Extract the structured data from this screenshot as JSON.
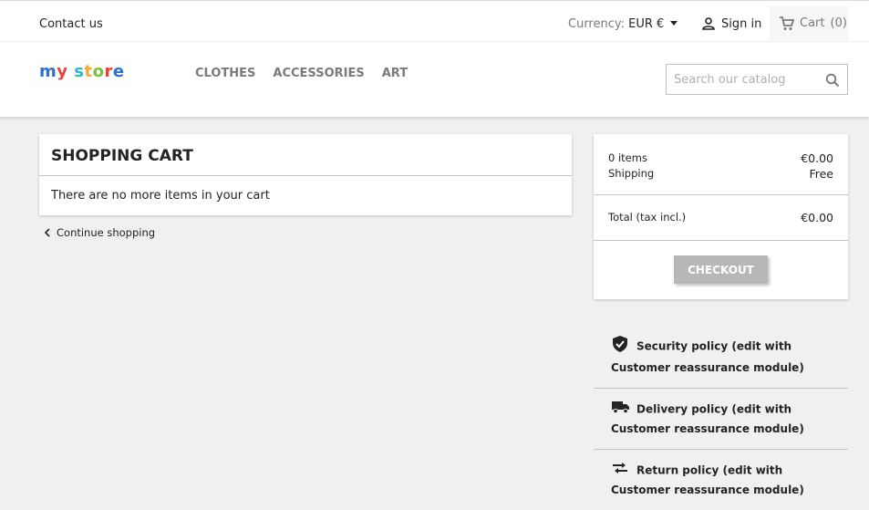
{
  "topbar": {
    "contact_label": "Contact us",
    "currency_label": "Currency:",
    "currency_value": "EUR €",
    "signin_label": "Sign in",
    "cart_label": "Cart",
    "cart_count": "(0)"
  },
  "header": {
    "logo_text": "my store",
    "nav": [
      "CLOTHES",
      "ACCESSORIES",
      "ART"
    ],
    "search_placeholder": "Search our catalog"
  },
  "cart": {
    "title": "SHOPPING CART",
    "empty_message": "There are no more items in your cart",
    "continue_label": "Continue shopping"
  },
  "summary": {
    "items_label": "0 items",
    "items_value": "€0.00",
    "shipping_label": "Shipping",
    "shipping_value": "Free",
    "total_label": "Total (tax incl.)",
    "total_value": "€0.00",
    "checkout_label": "CHECKOUT"
  },
  "reassurance": [
    {
      "icon": "shield-check-icon",
      "text": "Security policy (edit with Customer reassurance module)"
    },
    {
      "icon": "truck-icon",
      "text": "Delivery policy (edit with Customer reassurance module)"
    },
    {
      "icon": "swap-arrows-icon",
      "text": "Return policy (edit with Customer reassurance module)"
    }
  ],
  "colors": {
    "logo_m": "#2f6fce",
    "logo_y": "#e8423e",
    "logo_s": "#2fb5d2",
    "logo_t": "#f0a830",
    "logo_o": "#7bbd42",
    "logo_r": "#e8423e",
    "logo_e": "#2f6fce",
    "checkout_bg": "#b7b7b7"
  }
}
